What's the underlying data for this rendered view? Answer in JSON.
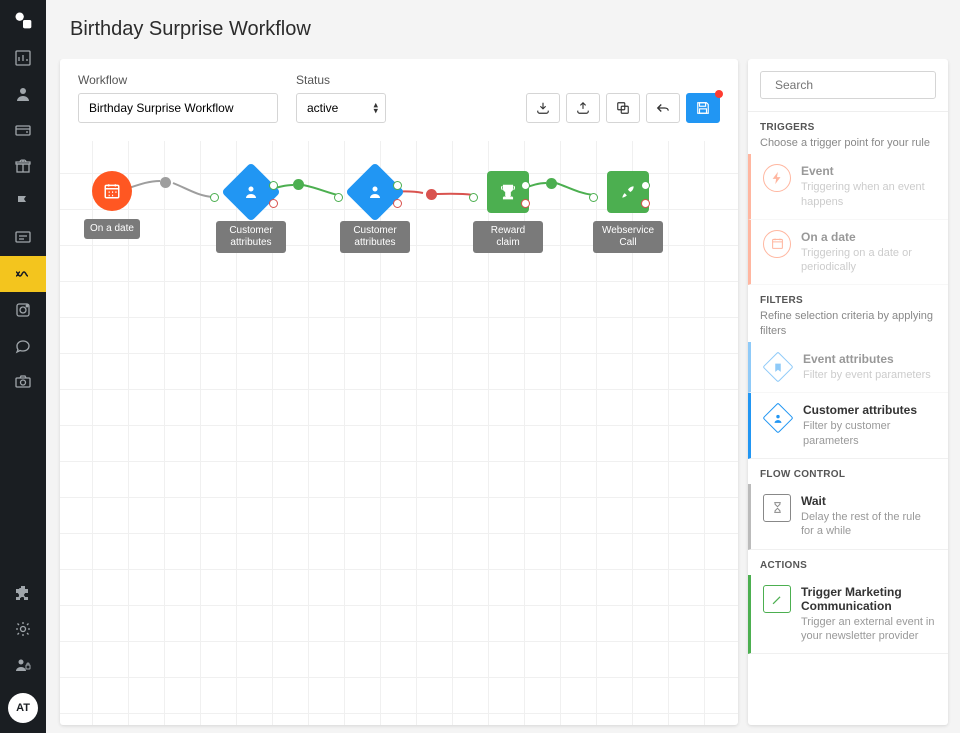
{
  "page_title": "Birthday Surprise Workflow",
  "avatar": "AT",
  "toolbar": {
    "workflow_label": "Workflow",
    "workflow_value": "Birthday Surprise Workflow",
    "status_label": "Status",
    "status_value": "active"
  },
  "nodes": [
    {
      "label": "On a date"
    },
    {
      "label": "Customer attributes"
    },
    {
      "label": "Customer attributes"
    },
    {
      "label": "Reward claim"
    },
    {
      "label": "Webservice Call"
    }
  ],
  "palette": {
    "search_placeholder": "Search",
    "sections": {
      "triggers": {
        "title": "TRIGGERS",
        "desc": "Choose a trigger point for your rule"
      },
      "filters": {
        "title": "FILTERS",
        "desc": "Refine selection criteria by applying filters"
      },
      "flow": {
        "title": "FLOW CONTROL"
      },
      "actions": {
        "title": "ACTIONS"
      }
    },
    "cards": {
      "event": {
        "title": "Event",
        "desc": "Triggering when an event happens"
      },
      "on_date": {
        "title": "On a date",
        "desc": "Triggering on a date or periodically"
      },
      "event_attr": {
        "title": "Event attributes",
        "desc": "Filter by event parameters"
      },
      "cust_attr": {
        "title": "Customer attributes",
        "desc": "Filter by customer parameters"
      },
      "wait": {
        "title": "Wait",
        "desc": "Delay the rest of the rule for a while"
      },
      "marketing": {
        "title": "Trigger Marketing Communication",
        "desc": "Trigger an external event in your newsletter provider"
      }
    }
  }
}
